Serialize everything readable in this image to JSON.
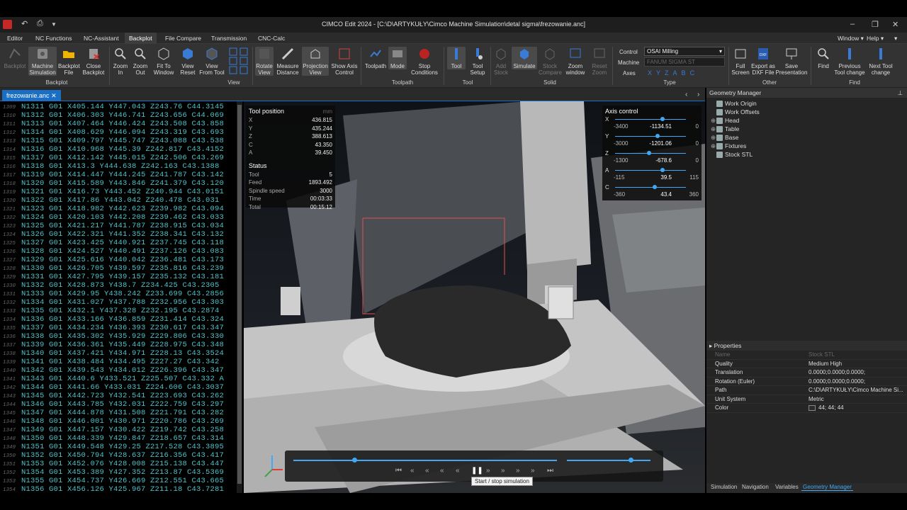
{
  "window": {
    "title": "CIMCO Edit 2024 - [C:\\D\\ARTYKUŁY\\Cimco Machine Simulation\\detal sigma\\frezowanie.anc]"
  },
  "menu": {
    "tabs": [
      "Editor",
      "NC Functions",
      "NC-Assistant",
      "Backplot",
      "File Compare",
      "Transmission",
      "CNC-Calc"
    ],
    "active": "Backplot",
    "window_label": "Window",
    "help_label": "Help"
  },
  "ribbon": {
    "backplot_group": [
      "Backplot",
      "Machine Simulation",
      "Backplot File",
      "Close Backplot"
    ],
    "backplot_label": "Backplot",
    "view_group": [
      "Zoom In",
      "Zoom Out",
      "Fit To Window",
      "View Reset",
      "View From Tool"
    ],
    "view_label": "View",
    "misc_group": [
      "Rotate View",
      "Measure Distance",
      "Projection View",
      "Show Axis Control"
    ],
    "toolpath_group": [
      "Toolpath",
      "Mode",
      "Stop Conditions"
    ],
    "toolpath_label": "Toolpath",
    "tool_group": [
      "Tool",
      "Tool Setup"
    ],
    "tool_label": "Tool",
    "solid_group": [
      "Add Stock",
      "Simulate",
      "Stock Compare",
      "Zoom window",
      "Reset Zoom"
    ],
    "solid_label": "Solid",
    "type": {
      "control_label": "Control",
      "control_value": "OSAI Milling",
      "machine_label": "Machine",
      "machine_value": "FANUM SIGMA ST",
      "axes_label": "Axes",
      "axes": [
        "X",
        "Y",
        "Z",
        "A",
        "B",
        "C"
      ]
    },
    "type_label": "Type",
    "other_group": [
      "Full Screen",
      "Export as DXF File",
      "Save Presentation"
    ],
    "other_label": "Other",
    "find_group": [
      "Find",
      "Previous Tool change",
      "Next Tool change"
    ],
    "find_label": "Find"
  },
  "document_tab": "frezowanie.anc",
  "editor": {
    "lines": [
      {
        "n": "1309",
        "code": "N1311 G01 X405.144 Y447.043 Z243.76 C44.3145"
      },
      {
        "n": "1310",
        "code": "N1312 G01 X406.303 Y446.741 Z243.656 C44.069"
      },
      {
        "n": "1311",
        "code": "N1313 G01 X407.464 Y446.424 Z243.508 C43.858"
      },
      {
        "n": "1312",
        "code": "N1314 G01 X408.629 Y446.094 Z243.319 C43.693"
      },
      {
        "n": "1313",
        "code": "N1315 G01 X409.797 Y445.747 Z243.088 C43.538"
      },
      {
        "n": "1314",
        "code": "N1316 G01 X410.968 Y445.39 Z242.817 C43.4152"
      },
      {
        "n": "1315",
        "code": "N1317 G01 X412.142 Y445.015 Z242.506 C43.269"
      },
      {
        "n": "1316",
        "code": "N1318 G01 X413.3 Y444.638 Z242.163 C43.1388"
      },
      {
        "n": "1317",
        "code": "N1319 G01 X414.447 Y444.245 Z241.787 C43.142"
      },
      {
        "n": "1318",
        "code": "N1320 G01 X415.589 Y443.846 Z241.379 C43.120"
      },
      {
        "n": "1319",
        "code": "N1321 G01 X416.73 Y443.452 Z240.944 C43.0151"
      },
      {
        "n": "1320",
        "code": "N1322 G01 X417.86 Y443.042 Z240.478 C43.031"
      },
      {
        "n": "1321",
        "code": "N1323 G01 X418.982 Y442.623 Z239.982 C43.094"
      },
      {
        "n": "1322",
        "code": "N1324 G01 X420.103 Y442.208 Z239.462 C43.033"
      },
      {
        "n": "1323",
        "code": "N1325 G01 X421.217 Y441.787 Z238.915 C43.034"
      },
      {
        "n": "1324",
        "code": "N1326 G01 X422.321 Y441.352 Z238.341 C43.132"
      },
      {
        "n": "1325",
        "code": "N1327 G01 X423.425 Y440.921 Z237.745 C43.118"
      },
      {
        "n": "1326",
        "code": "N1328 G01 X424.527 Y440.491 Z237.126 C43.083"
      },
      {
        "n": "1327",
        "code": "N1329 G01 X425.616 Y440.042 Z236.481 C43.173"
      },
      {
        "n": "1328",
        "code": "N1330 G01 X426.705 Y439.597 Z235.816 C43.239"
      },
      {
        "n": "1329",
        "code": "N1331 G01 X427.795 Y439.157 Z235.132 C43.181"
      },
      {
        "n": "1330",
        "code": "N1332 G01 X428.873 Y438.7 Z234.425 C43.2305"
      },
      {
        "n": "1331",
        "code": "N1333 G01 X429.95 Y438.242 Z233.699 C43.2856"
      },
      {
        "n": "1332",
        "code": "N1334 G01 X431.027 Y437.788 Z232.956 C43.303"
      },
      {
        "n": "1333",
        "code": "N1335 G01 X432.1 Y437.328 Z232.195 C43.2874"
      },
      {
        "n": "1334",
        "code": "N1336 G01 X433.166 Y436.859 Z231.414 C43.324"
      },
      {
        "n": "1335",
        "code": "N1337 G01 X434.234 Y436.393 Z230.617 C43.347"
      },
      {
        "n": "1336",
        "code": "N1338 G01 X435.302 Y435.929 Z229.806 C43.330"
      },
      {
        "n": "1337",
        "code": "N1339 G01 X436.361 Y435.449 Z228.975 C43.348"
      },
      {
        "n": "1338",
        "code": "N1340 G01 X437.421 Y434.971 Z228.13 C43.3524"
      },
      {
        "n": "1339",
        "code": "N1341 G01 X438.484 Y434.495 Z227.27 C43.342"
      },
      {
        "n": "1340",
        "code": "N1342 G01 X439.543 Y434.012 Z226.396 C43.347"
      },
      {
        "n": "1341",
        "code": "N1343 G01 X440.6 Y433.521 Z225.507 C43.332 A"
      },
      {
        "n": "1342",
        "code": "N1344 G01 X441.66 Y433.031 Z224.606 C43.3037"
      },
      {
        "n": "1343",
        "code": "N1345 G01 X442.723 Y432.541 Z223.693 C43.262"
      },
      {
        "n": "1344",
        "code": "N1346 G01 X443.785 Y432.031 Z222.759 C43.297"
      },
      {
        "n": "1345",
        "code": "N1347 G01 X444.878 Y431.508 Z221.791 C43.282"
      },
      {
        "n": "1346",
        "code": "N1348 G01 X446.001 Y430.971 Z220.786 C43.269"
      },
      {
        "n": "1347",
        "code": "N1349 G01 X447.157 Y430.422 Z219.742 C43.258"
      },
      {
        "n": "1348",
        "code": "N1350 G01 X448.339 Y429.847 Z218.657 C43.314"
      },
      {
        "n": "1349",
        "code": "N1351 G01 X449.548 Y429.25 Z217.528 C43.3895"
      },
      {
        "n": "1350",
        "code": "N1352 G01 X450.794 Y428.637 Z216.356 C43.417"
      },
      {
        "n": "1351",
        "code": "N1353 G01 X452.076 Y428.008 Z215.138 C43.447"
      },
      {
        "n": "1352",
        "code": "N1354 G01 X453.389 Y427.352 Z213.87 C43.5369"
      },
      {
        "n": "1353",
        "code": "N1355 G01 X454.737 Y426.669 Z212.551 C43.665"
      },
      {
        "n": "1354",
        "code": "N1356 G01 X456.126 Y425.967 Z211.18 C43.7281"
      }
    ]
  },
  "tool_position": {
    "title": "Tool position",
    "unit": "mm",
    "rows": [
      {
        "k": "X",
        "v": "436.815"
      },
      {
        "k": "Y",
        "v": "435.244"
      },
      {
        "k": "Z",
        "v": "388.613"
      },
      {
        "k": "C",
        "v": "43.350"
      },
      {
        "k": "A",
        "v": "39.450"
      }
    ],
    "status_title": "Status",
    "status": [
      {
        "k": "Tool",
        "v": "5"
      },
      {
        "k": "Feed",
        "v": "1893.492"
      },
      {
        "k": "Spindle speed",
        "v": "3000"
      },
      {
        "k": "Time",
        "v": "00:03:33"
      },
      {
        "k": "Total",
        "v": "00:15:12"
      }
    ]
  },
  "axis_control": {
    "title": "Axis control",
    "axes": [
      {
        "name": "X",
        "min": "-3400",
        "value": "-1134.51",
        "max": "0",
        "level": 0.67
      },
      {
        "name": "Y",
        "min": "-3000",
        "value": "-1201.06",
        "max": "0",
        "level": 0.6
      },
      {
        "name": "Z",
        "min": "-1300",
        "value": "-678.6",
        "max": "0",
        "level": 0.48
      },
      {
        "name": "A",
        "min": "-115",
        "value": "39.5",
        "max": "115",
        "level": 0.67
      },
      {
        "name": "C",
        "min": "-360",
        "value": "43.4",
        "max": "360",
        "level": 0.56
      }
    ]
  },
  "simulation": {
    "progress": 0.23,
    "speed": 0.76,
    "tooltip": "Start / stop simulation"
  },
  "geometry_manager": {
    "title": "Geometry Manager",
    "items": [
      {
        "label": "Work Origin",
        "expandable": false
      },
      {
        "label": "Work Offsets",
        "expandable": false
      },
      {
        "label": "Head",
        "expandable": true
      },
      {
        "label": "Table",
        "expandable": true
      },
      {
        "label": "Base",
        "expandable": true
      },
      {
        "label": "Fixtures",
        "expandable": true
      },
      {
        "label": "Stock STL",
        "expandable": false
      }
    ]
  },
  "properties": {
    "title": "Properties",
    "rows": [
      {
        "k": "Name",
        "v": "Stock STL",
        "dim": true
      },
      {
        "k": "Quality",
        "v": "Medium High"
      },
      {
        "k": "Translation",
        "v": "0.0000;0.0000;0.0000;"
      },
      {
        "k": "Rotation (Euler)",
        "v": "0.0000;0.0000;0.0000;"
      },
      {
        "k": "Path",
        "v": "C:\\D\\ARTYKUŁY\\Cimco Machine Si..."
      },
      {
        "k": "Unit System",
        "v": "Metric"
      },
      {
        "k": "Color",
        "v": "44; 44; 44"
      }
    ]
  },
  "bottom_tabs": [
    "Simulation",
    "Navigation",
    "Variables",
    "Geometry Manager"
  ],
  "bottom_tab_active": "Geometry Manager",
  "colors": {
    "accent": "#1a6fc4",
    "code": "#4fc3c9",
    "slider": "#3fa9f5"
  }
}
